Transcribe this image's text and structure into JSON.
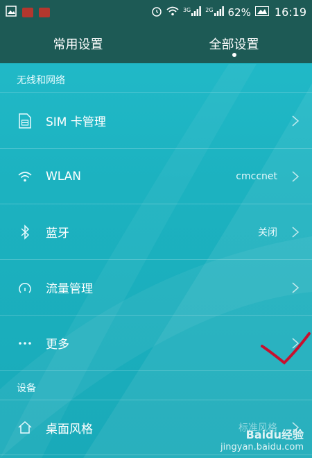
{
  "status_bar": {
    "signal_labels": [
      "3G",
      "2G"
    ],
    "battery": "62%",
    "time": "16:19"
  },
  "tabs": [
    {
      "label": "常用设置",
      "active": false
    },
    {
      "label": "全部设置",
      "active": true
    }
  ],
  "sections": [
    {
      "title": "无线和网络",
      "items": [
        {
          "label": "SIM 卡管理",
          "value": "",
          "icon": "sim-card-icon"
        },
        {
          "label": "WLAN",
          "value": "cmccnet",
          "icon": "wifi-icon"
        },
        {
          "label": "蓝牙",
          "value": "关闭",
          "icon": "bluetooth-icon"
        },
        {
          "label": "流量管理",
          "value": "",
          "icon": "data-usage-icon"
        },
        {
          "label": "更多",
          "value": "",
          "icon": "more-icon"
        }
      ]
    },
    {
      "title": "设备",
      "items": [
        {
          "label": "桌面风格",
          "value": "标准风格",
          "icon": "home-icon"
        }
      ]
    }
  ],
  "watermark": {
    "brand": "Baidu经验",
    "site": "jingyan.baidu.com"
  },
  "colors": {
    "header": "#1d5a55",
    "background": "#1fb6c3",
    "annotation": "#c8102e"
  }
}
